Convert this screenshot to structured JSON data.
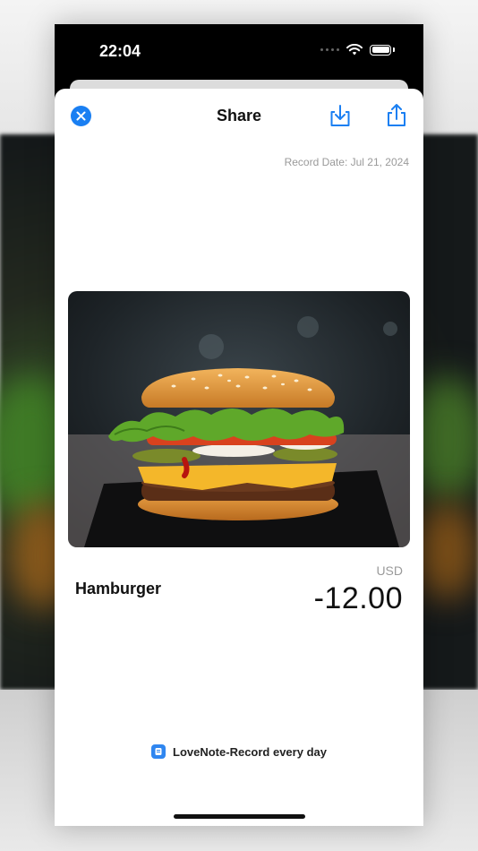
{
  "status": {
    "time": "22:04"
  },
  "nav": {
    "title": "Share",
    "close_icon": "close-icon",
    "download_icon": "download-icon",
    "share_icon": "share-icon"
  },
  "record": {
    "date_text": "Record Date: Jul 21, 2024"
  },
  "item": {
    "name": "Hamburger",
    "currency": "USD",
    "amount": "-12.00",
    "image": "hamburger-photo"
  },
  "footer": {
    "brand_text": "LoveNote-Record every day",
    "brand_icon": "app-icon"
  },
  "colors": {
    "accent": "#1a7ff2",
    "background": "#ffffff",
    "text": "#111111",
    "muted": "#9a9a9a"
  }
}
